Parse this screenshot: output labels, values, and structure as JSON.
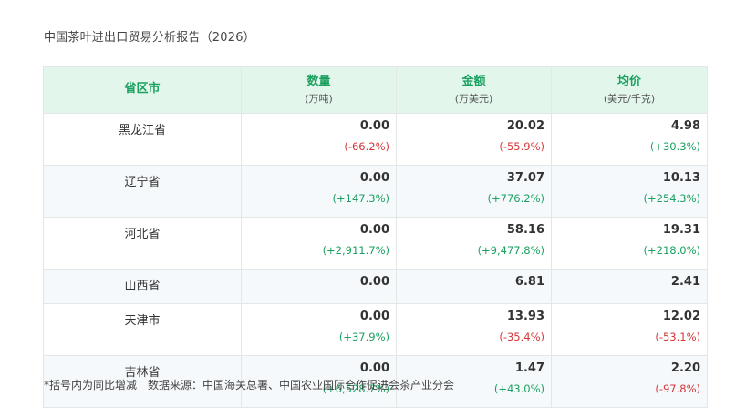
{
  "report": {
    "title": "中国茶叶进出口贸易分析报告（2026）",
    "footnote": "*括号内为同比增减　数据来源：中国海关总署、中国农业国际合作促进会茶产业分会"
  },
  "table": {
    "headers": [
      {
        "label": "省区市",
        "unit": ""
      },
      {
        "label": "数量",
        "unit": "(万吨)"
      },
      {
        "label": "金额",
        "unit": "(万美元)"
      },
      {
        "label": "均价",
        "unit": "(美元/千克)"
      }
    ],
    "rows": [
      {
        "province": "黑龙江省",
        "quantity": "0.00",
        "quantity_change": "(-66.2%)",
        "amount": "20.02",
        "amount_change": "(-55.9%)",
        "price": "4.98",
        "price_change": "(+30.3%)"
      },
      {
        "province": "辽宁省",
        "quantity": "0.00",
        "quantity_change": "(+147.3%)",
        "amount": "37.07",
        "amount_change": "(+776.2%)",
        "price": "10.13",
        "price_change": "(+254.3%)"
      },
      {
        "province": "河北省",
        "quantity": "0.00",
        "quantity_change": "(+2,911.7%)",
        "amount": "58.16",
        "amount_change": "(+9,477.8%)",
        "price": "19.31",
        "price_change": "(+218.0%)"
      },
      {
        "province": "山西省",
        "quantity": "0.00",
        "quantity_change": "",
        "amount": "6.81",
        "amount_change": "",
        "price": "2.41",
        "price_change": ""
      },
      {
        "province": "天津市",
        "quantity": "0.00",
        "quantity_change": "(+37.9%)",
        "amount": "13.93",
        "amount_change": "(-35.4%)",
        "price": "12.02",
        "price_change": "(-53.1%)"
      },
      {
        "province": "吉林省",
        "quantity": "0.00",
        "quantity_change": "(+6,528.7%)",
        "amount": "1.47",
        "amount_change": "(+43.0%)",
        "price": "2.20",
        "price_change": "(-97.8%)"
      }
    ]
  },
  "colors": {
    "accent": "#1aa15f",
    "header_bg": "#e3f6ec",
    "positive": "#1aa15f",
    "negative": "#d33838",
    "alt_row_bg": "#f6f9fb"
  }
}
